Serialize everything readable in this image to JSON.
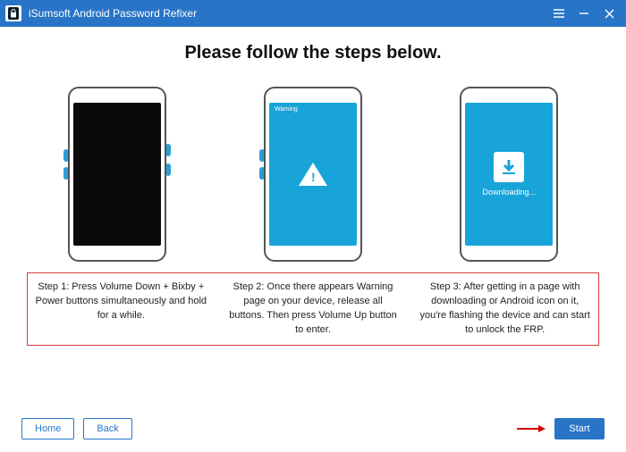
{
  "titlebar": {
    "title": "iSumsoft Android Password Refixer"
  },
  "main": {
    "heading": "Please follow the steps below.",
    "steps": [
      {
        "caption": "Step 1: Press Volume Down + Bixby + Power buttons simultaneously and hold for a while."
      },
      {
        "warn_label": "Warning",
        "caption": "Step 2: Once there appears Warning page on your device, release all buttons. Then press Volume Up button to enter."
      },
      {
        "download_text": "Downloading...",
        "caption": "Step 3: After getting in a page with downloading or Android icon on it, you're flashing the device and can start to unlock the FRP."
      }
    ]
  },
  "footer": {
    "home": "Home",
    "back": "Back",
    "start": "Start"
  }
}
